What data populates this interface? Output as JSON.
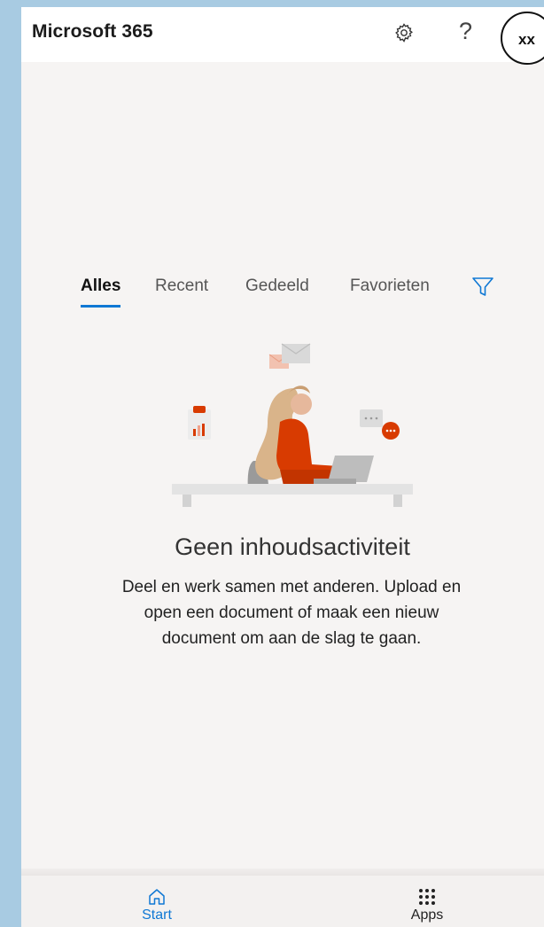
{
  "header": {
    "title": "Microsoft 365",
    "avatar_initials": "xx"
  },
  "icons": {
    "settings": "gear-icon",
    "help": "question-icon",
    "filter": "funnel-icon",
    "home": "home-icon",
    "apps": "grid-dots-icon"
  },
  "help_glyph": "?",
  "tabs": [
    {
      "label": "Alles",
      "active": true
    },
    {
      "label": "Recent",
      "active": false
    },
    {
      "label": "Gedeeld",
      "active": false
    },
    {
      "label": "Favorieten",
      "active": false
    }
  ],
  "empty_state": {
    "title": "Geen inhoudsactiviteit",
    "body": "Deel en werk samen met anderen. Upload en open een document of maak een nieuw document om aan de slag te gaan."
  },
  "bottom_nav": [
    {
      "label": "Start",
      "active": true
    },
    {
      "label": "Apps",
      "active": false
    }
  ],
  "colors": {
    "accent": "#0f78d4",
    "illustration_red": "#d83b01",
    "background": "#f6f4f3",
    "frame": "#a8cbe2"
  }
}
